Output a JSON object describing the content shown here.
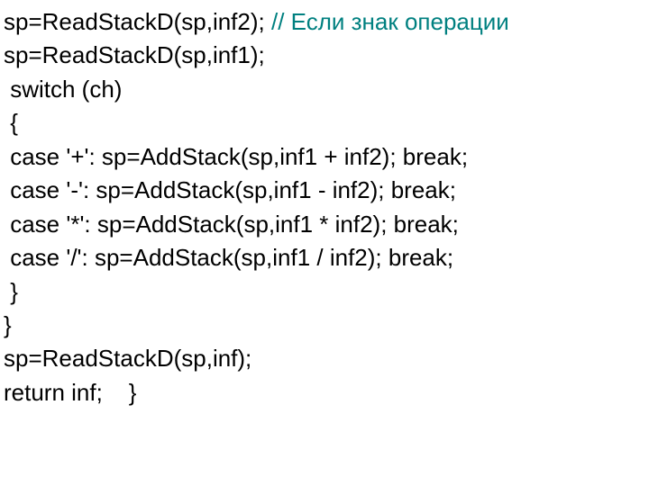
{
  "lines": {
    "l1_code": "sp=ReadStackD(sp,inf2); ",
    "l1_comment": "// Если знак операции",
    "l2": "sp=ReadStackD(sp,inf1);",
    "l3": " switch (ch)",
    "l4": " {",
    "l5": " case '+': sp=AddStack(sp,inf1 + inf2); break;",
    "l6": " case '-': sp=AddStack(sp,inf1 - inf2); break;",
    "l7": " case '*': sp=AddStack(sp,inf1 * inf2); break;",
    "l8": " case '/': sp=AddStack(sp,inf1 / inf2); break;",
    "l9": " }",
    "l10": "}",
    "l11": "sp=ReadStackD(sp,inf);",
    "l12": "return inf;    }"
  }
}
